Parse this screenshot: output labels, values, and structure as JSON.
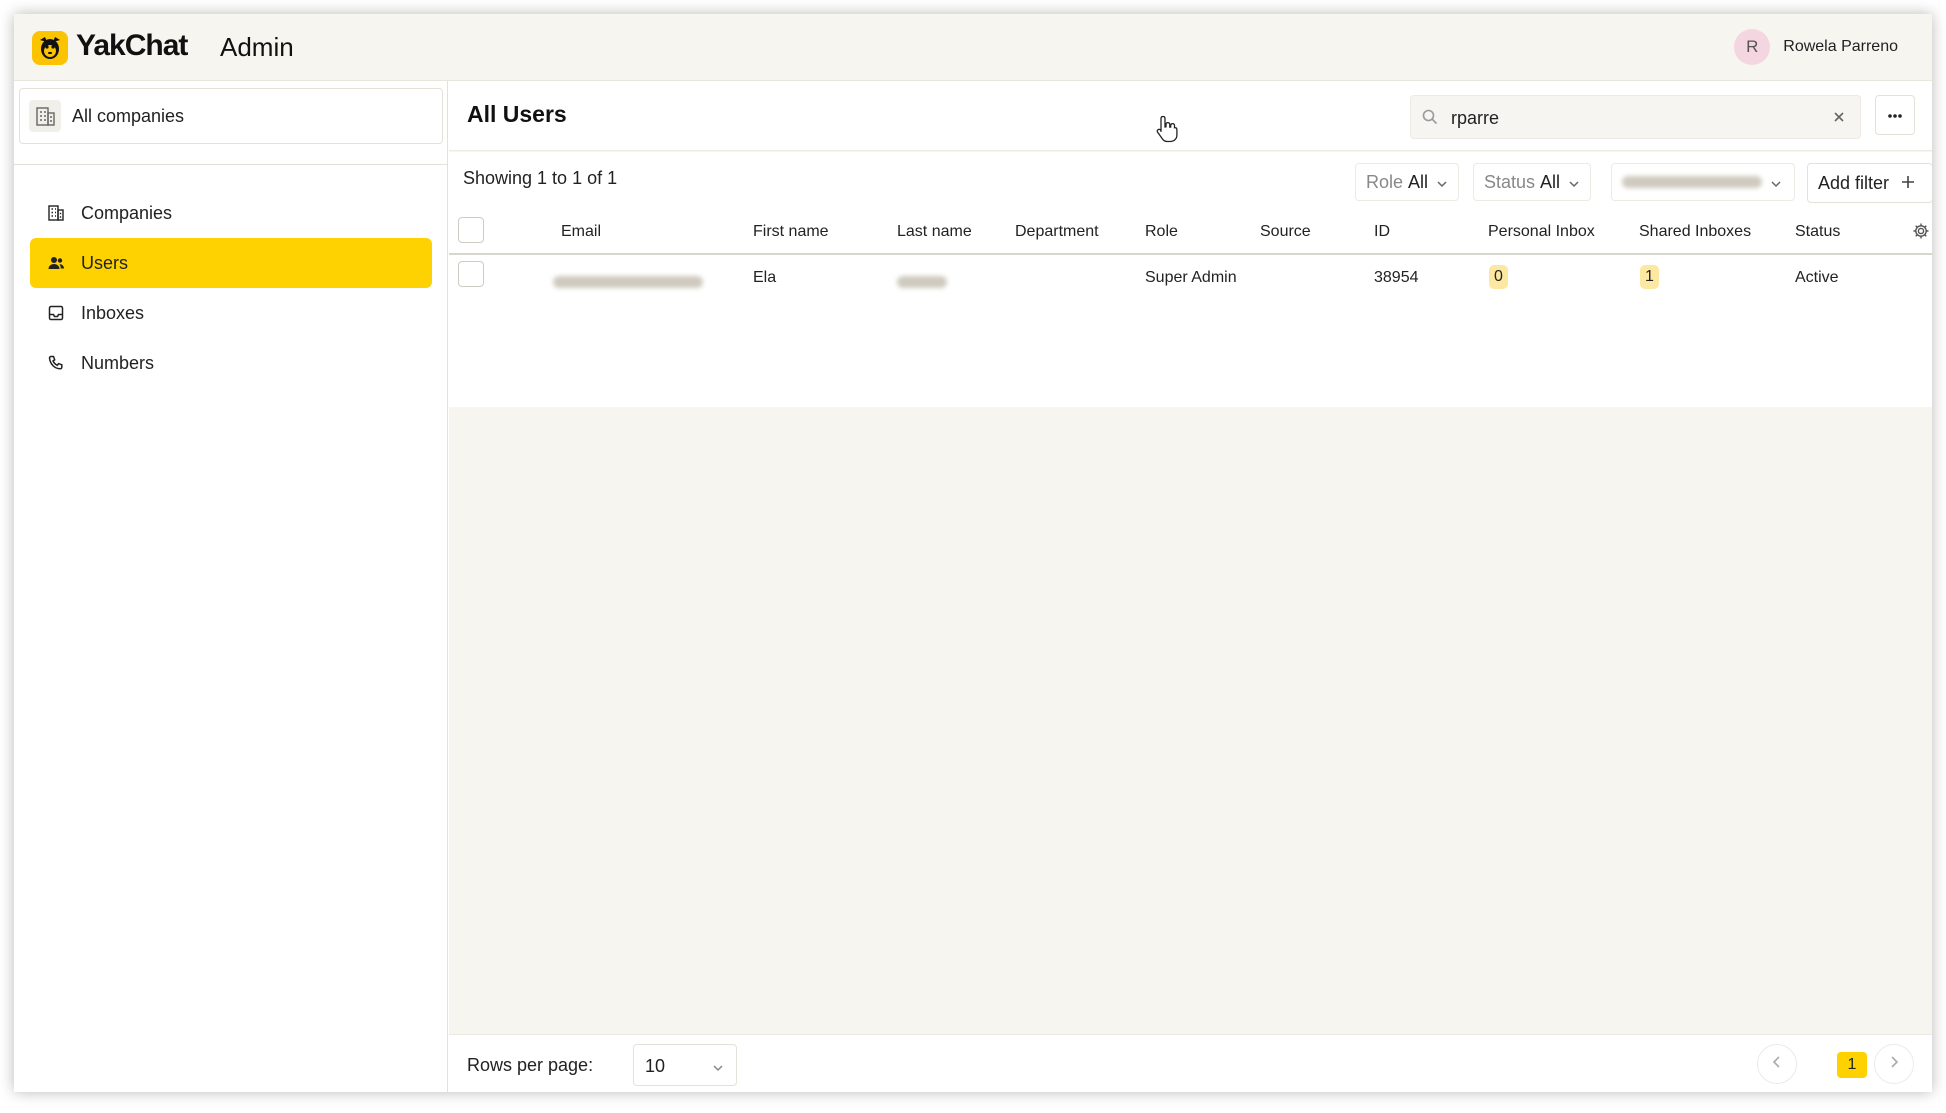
{
  "header": {
    "brand": "YakChat",
    "section": "Admin",
    "user_initial": "R",
    "user_name": "Rowela Parreno"
  },
  "sidebar": {
    "company_selector": "All companies",
    "items": [
      {
        "label": "Companies",
        "icon": "building-icon",
        "active": false
      },
      {
        "label": "Users",
        "icon": "users-icon",
        "active": true
      },
      {
        "label": "Inboxes",
        "icon": "inbox-icon",
        "active": false
      },
      {
        "label": "Numbers",
        "icon": "phone-icon",
        "active": false
      }
    ]
  },
  "main": {
    "title": "All Users",
    "search": {
      "value": "rparre"
    },
    "showing": "Showing 1 to 1 of 1",
    "filters": {
      "role_label": "Role",
      "role_value": "All",
      "status_label": "Status",
      "status_value": "All",
      "add_filter": "Add filter"
    },
    "table": {
      "columns": [
        "Email",
        "First name",
        "Last name",
        "Department",
        "Role",
        "Source",
        "ID",
        "Personal Inbox",
        "Shared Inboxes",
        "Status"
      ],
      "rows": [
        {
          "email": "",
          "first_name": "Ela",
          "last_name": "",
          "department": "",
          "role": "Super Admin",
          "source": "",
          "id": "38954",
          "personal_inbox": "0",
          "shared_inboxes": "1",
          "status": "Active"
        }
      ]
    },
    "pagination": {
      "rows_per_page_label": "Rows per page:",
      "rows_per_page": "10",
      "current_page": "1"
    }
  },
  "colors": {
    "accent": "#fed200",
    "pill": "#fde8a2",
    "background": "#f7f5f0"
  }
}
